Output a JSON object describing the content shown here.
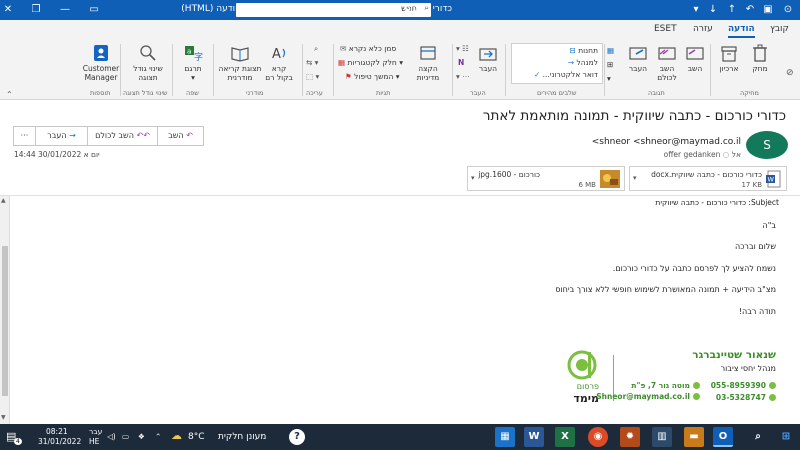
{
  "window": {
    "title": "כדורי כורכום - כתבה שיווקית - תמונה מותאמת לאתר - הודעה (HTML)",
    "search_placeholder": "חפש"
  },
  "tabs": [
    "קובץ",
    "הודעה",
    "עזרה",
    "ESET"
  ],
  "active_tab": "הודעה",
  "ribbon": {
    "delete": {
      "remove": "מחק",
      "archive": "ארכיון"
    },
    "respond": {
      "reply": "השב",
      "reply_all": "השב לכולם",
      "forward": "העבר"
    },
    "quick_steps": {
      "items": [
        "תחנות",
        "למנהל",
        "דואר אלקטרוני..."
      ]
    },
    "move": {
      "move": "העבר",
      "onenote": ""
    },
    "tags": {
      "rules": "הקצה מדיניות",
      "unread": "סמן כלא נקרא",
      "categorize": "חלק לקטגוריות",
      "follow_up": "המשך טיפול"
    },
    "editing": {},
    "immersive": {
      "read_aloud": "קרא בקול רם",
      "immersive_reader": "תצוגת קריאה מודרנית"
    },
    "language": {
      "translate": "תרגם"
    },
    "zoom": {
      "zoom": "שינוי גודל תצוגה"
    },
    "addins": {
      "customer_manager": "Customer Manager"
    },
    "group_labels": {
      "delete": "מחיקה",
      "respond": "תגובה",
      "quick_steps": "שלבים מהירים",
      "move": "העבר",
      "tags": "תגיות",
      "editing": "עריכה",
      "immersive": "מודרני",
      "language": "שפה",
      "zoom": "שינוי גודל תצוגה",
      "addins": "תוספות"
    }
  },
  "message": {
    "subject": "כדורי כורכום - כתבה שיווקית - תמונה מותאמת לאתר",
    "actions": {
      "reply": "השב",
      "reply_all": "השב לכולם",
      "forward": "העבר",
      "more": "···"
    },
    "avatar_letter": "S",
    "sender": "shneor <shneor@maymad.co.il>",
    "to_label": "אל",
    "to": "offer gedanken",
    "date": "יום א 30/01/2022 14:44",
    "attachments": [
      {
        "name": "כדורי כורכום - כתבה שיווקית.docx",
        "size": "17 KB"
      },
      {
        "name": "כורכום - 1600.jpg",
        "size": "6 MB"
      }
    ],
    "subject_field": "Subject: כדורי כורכום - כתבה שיווקית"
  },
  "body": {
    "lines": [
      "ב\"ה",
      "שלום וברכה",
      "נשמח להציע לך לפרסם כתבה על כדורי כורכום.",
      "מצ\"ב הידיעה + תמונה המאושרת לשימוש חופשי ללא צורך ביחוס",
      "תודה רבה!"
    ]
  },
  "signature": {
    "name": "שנאור שטיינברגר",
    "role": "מנהל יחסי ציבור",
    "phone1": "055-8959390",
    "phone2": "03-5328747",
    "address": "מוטה גור 7, פ\"ת",
    "email": "Shneor@maymad.co.il",
    "logo_text_1": "פרסום",
    "logo_text_2": "מימד"
  },
  "taskbar": {
    "weather_temp": "8°C",
    "weather_text": "מעונן חלקית",
    "language": "עבר",
    "language_sub": "HE",
    "time": "08:21",
    "date": "31/01/2022",
    "notif_count": "4"
  },
  "colors": {
    "accent": "#0f5fb7",
    "brand_green": "#3c8c2a"
  }
}
